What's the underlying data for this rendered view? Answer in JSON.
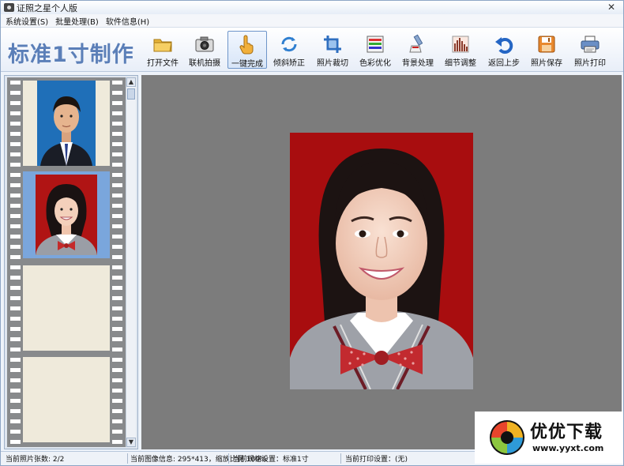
{
  "window": {
    "title": "证照之星个人版",
    "close_glyph": "✕"
  },
  "menu": [
    {
      "label": "系统设置(S)"
    },
    {
      "label": "批量处理(B)"
    },
    {
      "label": "软件信息(H)"
    }
  ],
  "toolbar": {
    "logo_text": "标准1寸制作",
    "buttons": [
      {
        "label": "打开文件",
        "icon": "folder-icon"
      },
      {
        "label": "联机拍摄",
        "icon": "camera-icon"
      },
      {
        "label": "一键完成",
        "icon": "hand-pointer-icon",
        "active": true
      },
      {
        "label": "倾斜矫正",
        "icon": "rotate-icon"
      },
      {
        "label": "照片裁切",
        "icon": "crop-icon"
      },
      {
        "label": "色彩优化",
        "icon": "palette-icon"
      },
      {
        "label": "背景处理",
        "icon": "brush-icon"
      },
      {
        "label": "细节调整",
        "icon": "levels-icon"
      },
      {
        "label": "返回上步",
        "icon": "undo-icon"
      },
      {
        "label": "照片保存",
        "icon": "save-icon"
      },
      {
        "label": "照片打印",
        "icon": "printer-icon"
      }
    ]
  },
  "filmstrip": {
    "frames": [
      {
        "kind": "photo",
        "background": "#1f6fb8",
        "subject": "man-in-suit"
      },
      {
        "kind": "photo",
        "background": "#b01414",
        "subject": "woman-in-uniform",
        "selected": true
      },
      {
        "kind": "empty"
      },
      {
        "kind": "empty"
      }
    ]
  },
  "canvas": {
    "background": "#7c7c7c",
    "photo_background": "#a80d0f"
  },
  "status": {
    "photo_count": "当前照片张数: 2/2",
    "image_info": "当前图像信息: 295*413，缩放比例 100%",
    "spec_setting": "当前规格设置：标准1寸",
    "print_setting": "当前打印设置：(无)"
  },
  "watermark": {
    "title": "优优下载",
    "url": "www.yyxt.com"
  },
  "colors": {
    "accent": "#5b7fb8",
    "border": "#8ea6c6"
  }
}
